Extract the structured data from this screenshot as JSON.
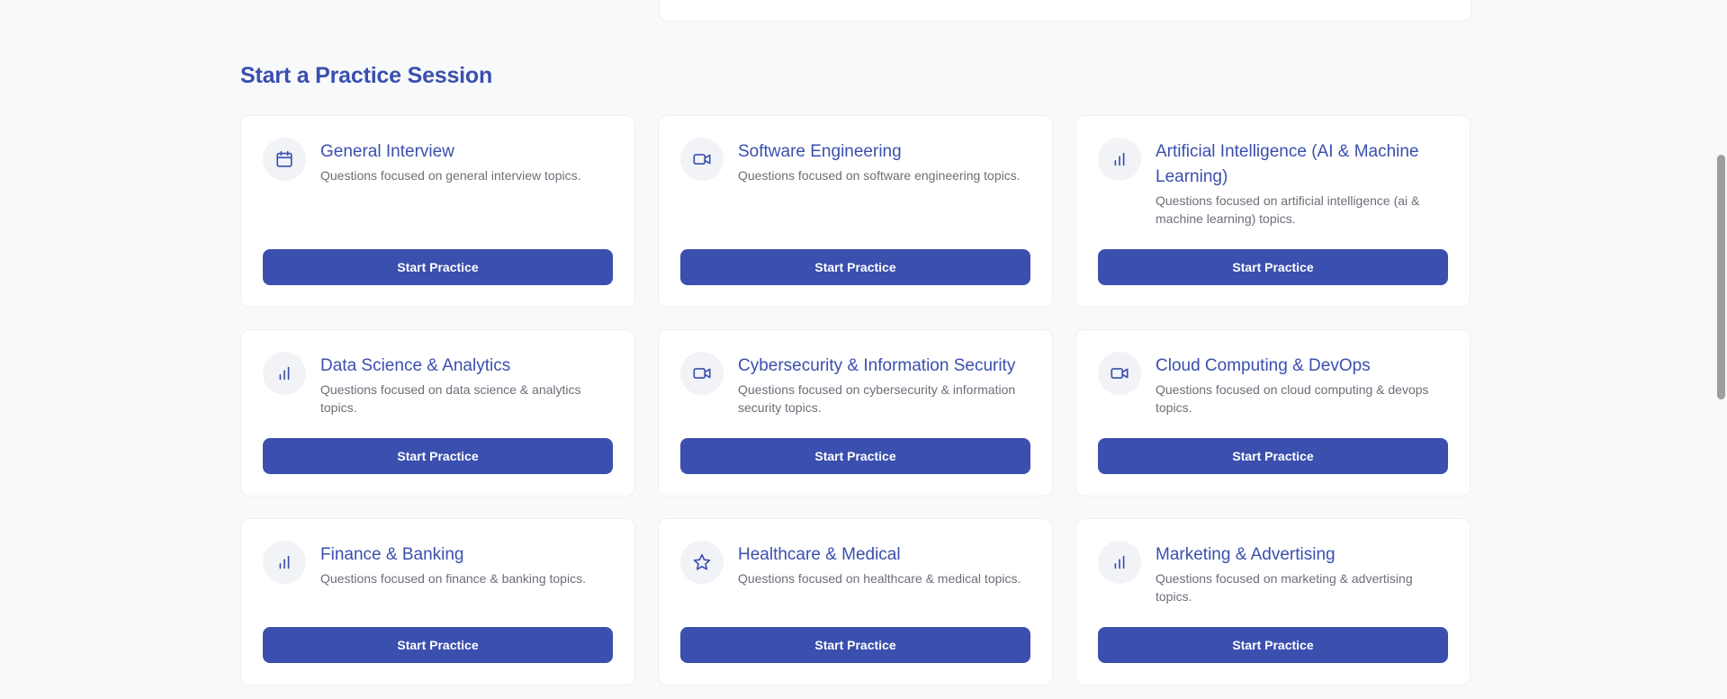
{
  "section": {
    "title": "Start a Practice Session"
  },
  "button_label": "Start Practice",
  "colors": {
    "accent": "#3a4fae",
    "background": "#f8f9fb",
    "card": "#ffffff",
    "description": "#6b6f78"
  },
  "cards": [
    {
      "icon": "calendar-icon",
      "title": "General Interview",
      "description": "Questions focused on general interview topics.",
      "button": "Start Practice"
    },
    {
      "icon": "video-icon",
      "title": "Software Engineering",
      "description": "Questions focused on software engineering topics.",
      "button": "Start Practice"
    },
    {
      "icon": "bar-chart-icon",
      "title": "Artificial Intelligence (AI & Machine Learning)",
      "description": "Questions focused on artificial intelligence (ai & machine learning) topics.",
      "button": "Start Practice"
    },
    {
      "icon": "bar-chart-icon",
      "title": "Data Science & Analytics",
      "description": "Questions focused on data science & analytics topics.",
      "button": "Start Practice"
    },
    {
      "icon": "video-icon",
      "title": "Cybersecurity & Information Security",
      "description": "Questions focused on cybersecurity & information security topics.",
      "button": "Start Practice"
    },
    {
      "icon": "video-icon",
      "title": "Cloud Computing & DevOps",
      "description": "Questions focused on cloud computing & devops topics.",
      "button": "Start Practice"
    },
    {
      "icon": "bar-chart-icon",
      "title": "Finance & Banking",
      "description": "Questions focused on finance & banking topics.",
      "button": "Start Practice"
    },
    {
      "icon": "star-icon",
      "title": "Healthcare & Medical",
      "description": "Questions focused on healthcare & medical topics.",
      "button": "Start Practice"
    },
    {
      "icon": "bar-chart-icon",
      "title": "Marketing & Advertising",
      "description": "Questions focused on marketing & advertising topics.",
      "button": "Start Practice"
    }
  ]
}
